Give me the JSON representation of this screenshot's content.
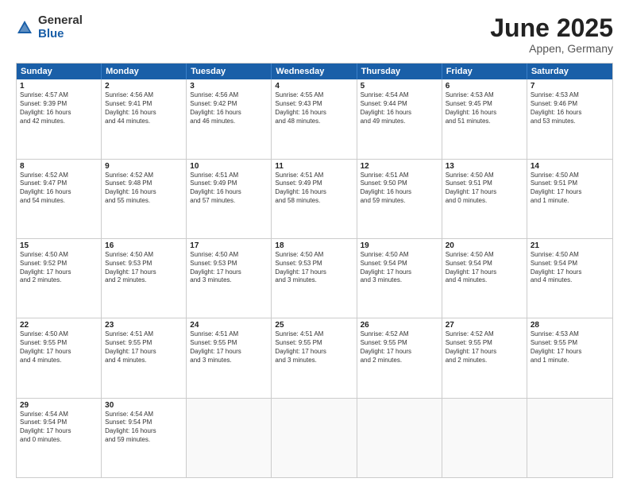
{
  "logo": {
    "general": "General",
    "blue": "Blue"
  },
  "title": {
    "month": "June 2025",
    "location": "Appen, Germany"
  },
  "header_days": [
    "Sunday",
    "Monday",
    "Tuesday",
    "Wednesday",
    "Thursday",
    "Friday",
    "Saturday"
  ],
  "weeks": [
    [
      {
        "day": "1",
        "lines": [
          "Sunrise: 4:57 AM",
          "Sunset: 9:39 PM",
          "Daylight: 16 hours",
          "and 42 minutes."
        ]
      },
      {
        "day": "2",
        "lines": [
          "Sunrise: 4:56 AM",
          "Sunset: 9:41 PM",
          "Daylight: 16 hours",
          "and 44 minutes."
        ]
      },
      {
        "day": "3",
        "lines": [
          "Sunrise: 4:56 AM",
          "Sunset: 9:42 PM",
          "Daylight: 16 hours",
          "and 46 minutes."
        ]
      },
      {
        "day": "4",
        "lines": [
          "Sunrise: 4:55 AM",
          "Sunset: 9:43 PM",
          "Daylight: 16 hours",
          "and 48 minutes."
        ]
      },
      {
        "day": "5",
        "lines": [
          "Sunrise: 4:54 AM",
          "Sunset: 9:44 PM",
          "Daylight: 16 hours",
          "and 49 minutes."
        ]
      },
      {
        "day": "6",
        "lines": [
          "Sunrise: 4:53 AM",
          "Sunset: 9:45 PM",
          "Daylight: 16 hours",
          "and 51 minutes."
        ]
      },
      {
        "day": "7",
        "lines": [
          "Sunrise: 4:53 AM",
          "Sunset: 9:46 PM",
          "Daylight: 16 hours",
          "and 53 minutes."
        ]
      }
    ],
    [
      {
        "day": "8",
        "lines": [
          "Sunrise: 4:52 AM",
          "Sunset: 9:47 PM",
          "Daylight: 16 hours",
          "and 54 minutes."
        ]
      },
      {
        "day": "9",
        "lines": [
          "Sunrise: 4:52 AM",
          "Sunset: 9:48 PM",
          "Daylight: 16 hours",
          "and 55 minutes."
        ]
      },
      {
        "day": "10",
        "lines": [
          "Sunrise: 4:51 AM",
          "Sunset: 9:49 PM",
          "Daylight: 16 hours",
          "and 57 minutes."
        ]
      },
      {
        "day": "11",
        "lines": [
          "Sunrise: 4:51 AM",
          "Sunset: 9:49 PM",
          "Daylight: 16 hours",
          "and 58 minutes."
        ]
      },
      {
        "day": "12",
        "lines": [
          "Sunrise: 4:51 AM",
          "Sunset: 9:50 PM",
          "Daylight: 16 hours",
          "and 59 minutes."
        ]
      },
      {
        "day": "13",
        "lines": [
          "Sunrise: 4:50 AM",
          "Sunset: 9:51 PM",
          "Daylight: 17 hours",
          "and 0 minutes."
        ]
      },
      {
        "day": "14",
        "lines": [
          "Sunrise: 4:50 AM",
          "Sunset: 9:51 PM",
          "Daylight: 17 hours",
          "and 1 minute."
        ]
      }
    ],
    [
      {
        "day": "15",
        "lines": [
          "Sunrise: 4:50 AM",
          "Sunset: 9:52 PM",
          "Daylight: 17 hours",
          "and 2 minutes."
        ]
      },
      {
        "day": "16",
        "lines": [
          "Sunrise: 4:50 AM",
          "Sunset: 9:53 PM",
          "Daylight: 17 hours",
          "and 2 minutes."
        ]
      },
      {
        "day": "17",
        "lines": [
          "Sunrise: 4:50 AM",
          "Sunset: 9:53 PM",
          "Daylight: 17 hours",
          "and 3 minutes."
        ]
      },
      {
        "day": "18",
        "lines": [
          "Sunrise: 4:50 AM",
          "Sunset: 9:53 PM",
          "Daylight: 17 hours",
          "and 3 minutes."
        ]
      },
      {
        "day": "19",
        "lines": [
          "Sunrise: 4:50 AM",
          "Sunset: 9:54 PM",
          "Daylight: 17 hours",
          "and 3 minutes."
        ]
      },
      {
        "day": "20",
        "lines": [
          "Sunrise: 4:50 AM",
          "Sunset: 9:54 PM",
          "Daylight: 17 hours",
          "and 4 minutes."
        ]
      },
      {
        "day": "21",
        "lines": [
          "Sunrise: 4:50 AM",
          "Sunset: 9:54 PM",
          "Daylight: 17 hours",
          "and 4 minutes."
        ]
      }
    ],
    [
      {
        "day": "22",
        "lines": [
          "Sunrise: 4:50 AM",
          "Sunset: 9:55 PM",
          "Daylight: 17 hours",
          "and 4 minutes."
        ]
      },
      {
        "day": "23",
        "lines": [
          "Sunrise: 4:51 AM",
          "Sunset: 9:55 PM",
          "Daylight: 17 hours",
          "and 4 minutes."
        ]
      },
      {
        "day": "24",
        "lines": [
          "Sunrise: 4:51 AM",
          "Sunset: 9:55 PM",
          "Daylight: 17 hours",
          "and 3 minutes."
        ]
      },
      {
        "day": "25",
        "lines": [
          "Sunrise: 4:51 AM",
          "Sunset: 9:55 PM",
          "Daylight: 17 hours",
          "and 3 minutes."
        ]
      },
      {
        "day": "26",
        "lines": [
          "Sunrise: 4:52 AM",
          "Sunset: 9:55 PM",
          "Daylight: 17 hours",
          "and 2 minutes."
        ]
      },
      {
        "day": "27",
        "lines": [
          "Sunrise: 4:52 AM",
          "Sunset: 9:55 PM",
          "Daylight: 17 hours",
          "and 2 minutes."
        ]
      },
      {
        "day": "28",
        "lines": [
          "Sunrise: 4:53 AM",
          "Sunset: 9:55 PM",
          "Daylight: 17 hours",
          "and 1 minute."
        ]
      }
    ],
    [
      {
        "day": "29",
        "lines": [
          "Sunrise: 4:54 AM",
          "Sunset: 9:54 PM",
          "Daylight: 17 hours",
          "and 0 minutes."
        ]
      },
      {
        "day": "30",
        "lines": [
          "Sunrise: 4:54 AM",
          "Sunset: 9:54 PM",
          "Daylight: 16 hours",
          "and 59 minutes."
        ]
      },
      {
        "day": "",
        "lines": []
      },
      {
        "day": "",
        "lines": []
      },
      {
        "day": "",
        "lines": []
      },
      {
        "day": "",
        "lines": []
      },
      {
        "day": "",
        "lines": []
      }
    ]
  ]
}
